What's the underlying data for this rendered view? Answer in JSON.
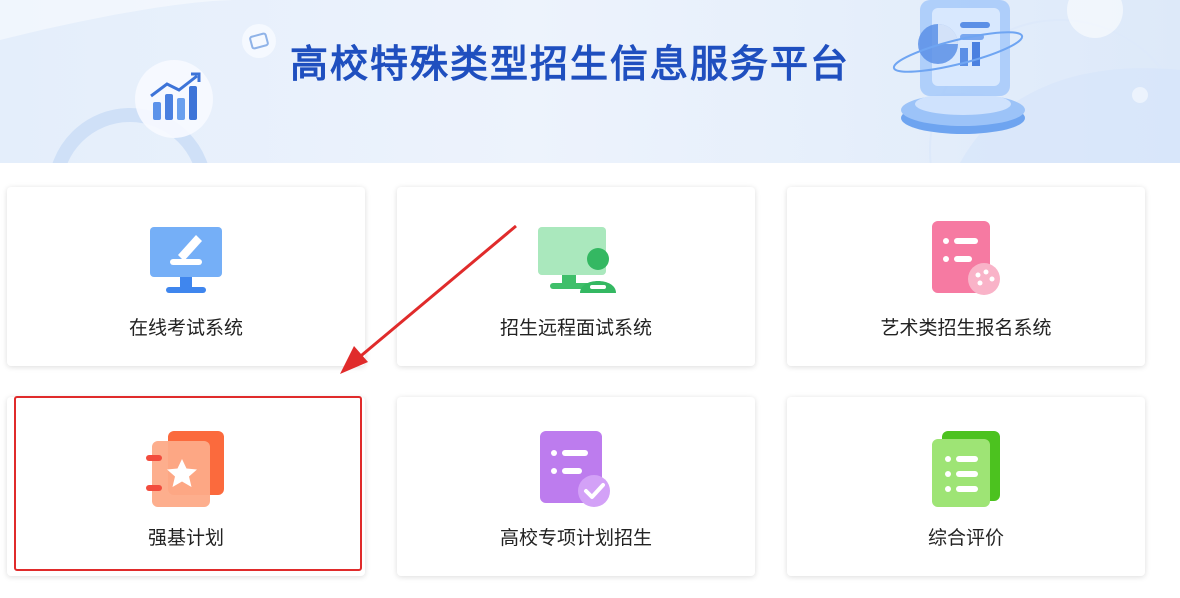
{
  "header": {
    "title": "高校特殊类型招生信息服务平台"
  },
  "cards": [
    {
      "label": "在线考试系统",
      "icon": "monitor-pen-icon"
    },
    {
      "label": "招生远程面试系统",
      "icon": "remote-interview-icon"
    },
    {
      "label": "艺术类招生报名系统",
      "icon": "art-registration-icon"
    },
    {
      "label": "强基计划",
      "icon": "star-notebook-icon"
    },
    {
      "label": "高校专项计划招生",
      "icon": "checklist-document-icon"
    },
    {
      "label": "综合评价",
      "icon": "list-document-icon"
    }
  ],
  "colors": {
    "title": "#1f4fbf",
    "highlight": "#e02b2b",
    "exam": "#4a90f0",
    "interview": "#3fbf6a",
    "art": "#f26a93",
    "qiangji": "#fb6a3d",
    "special": "#a65be8",
    "evaluation": "#5cc92b"
  }
}
